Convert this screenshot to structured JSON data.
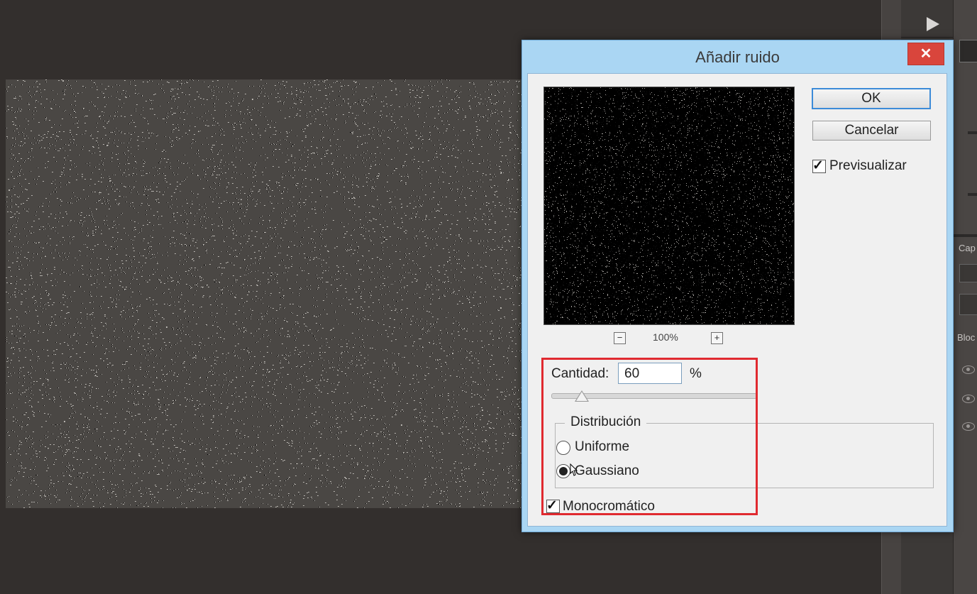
{
  "dialog": {
    "title": "Añadir ruido",
    "close_symbol": "✕",
    "ok_label": "OK",
    "cancel_label": "Cancelar",
    "preview_label": "Previsualizar",
    "preview_checked": true,
    "zoom": {
      "minus": "−",
      "plus": "+",
      "level": "100%"
    },
    "amount": {
      "label": "Cantidad:",
      "value": "60",
      "unit": "%",
      "slider_level_fraction": 0.15
    },
    "distribution": {
      "legend": "Distribución",
      "options": [
        {
          "label": "Uniforme",
          "selected": false
        },
        {
          "label": "Gaussiano",
          "selected": true
        }
      ]
    },
    "monochromatic": {
      "label": "Monocromático",
      "checked": true
    },
    "highlight_color": "#e02a30"
  },
  "right_panel": {
    "labels": [
      "Cap",
      "Bloc"
    ]
  },
  "icons": {
    "play": "play-icon",
    "search": "search-icon",
    "eye": "eye-icon",
    "check": "checkmark-icon",
    "cursor": "mouse-cursor-icon"
  }
}
